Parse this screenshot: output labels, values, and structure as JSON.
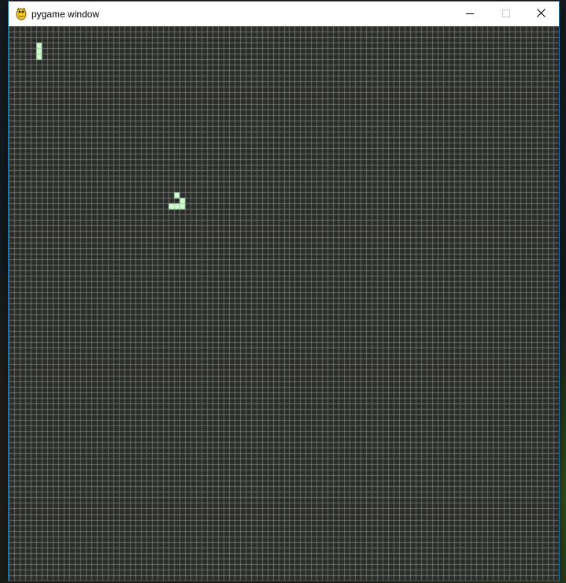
{
  "window": {
    "title": "pygame window",
    "icon": "pygame-snake-icon",
    "controls": {
      "minimize_icon": "minimize-icon",
      "maximize_icon": "maximize-icon",
      "close_icon": "close-icon"
    }
  },
  "board": {
    "columns": 100,
    "rows": 100,
    "background_color": "#2b2c2a",
    "grid_line_color": "#9aa399",
    "live_cell_color": "#ccffcc",
    "live_cells": [
      [
        5,
        3
      ],
      [
        5,
        4
      ],
      [
        5,
        5
      ],
      [
        30,
        30
      ],
      [
        31,
        31
      ],
      [
        29,
        32
      ],
      [
        30,
        32
      ],
      [
        31,
        32
      ]
    ]
  }
}
